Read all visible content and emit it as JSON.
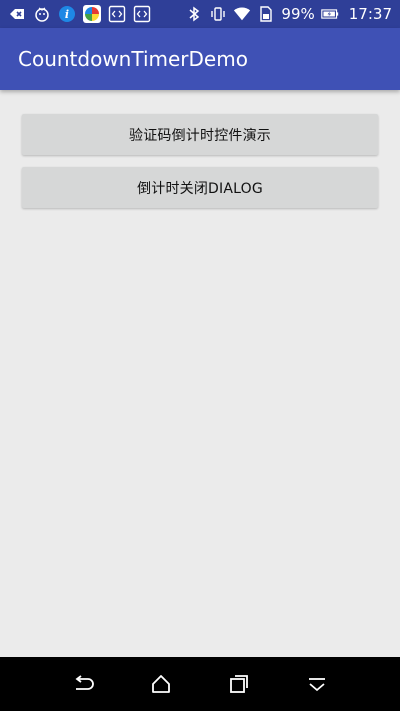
{
  "status_bar": {
    "battery_percent": "99%",
    "time": "17:37",
    "left_icons": [
      "back-arrow-app-icon",
      "notification-face-icon",
      "info-app-icon",
      "colorful-app-icon",
      "code-app-icon",
      "code-app-icon-2"
    ],
    "right_icons": [
      "bluetooth-icon",
      "vibrate-icon",
      "wifi-icon",
      "sim-icon",
      "battery-icon"
    ]
  },
  "app_bar": {
    "title": "CountdownTimerDemo",
    "color": "#3f51b5"
  },
  "buttons": [
    {
      "label": "验证码倒计时控件演示"
    },
    {
      "label": "倒计时关闭DIALOG"
    }
  ],
  "nav_bar": {
    "icons": [
      "back-icon",
      "home-icon",
      "recents-icon",
      "hide-keyboard-icon"
    ]
  },
  "colors": {
    "status_bar": "#2f3f98",
    "background": "#ebebeb",
    "button": "#d6d7d7"
  }
}
